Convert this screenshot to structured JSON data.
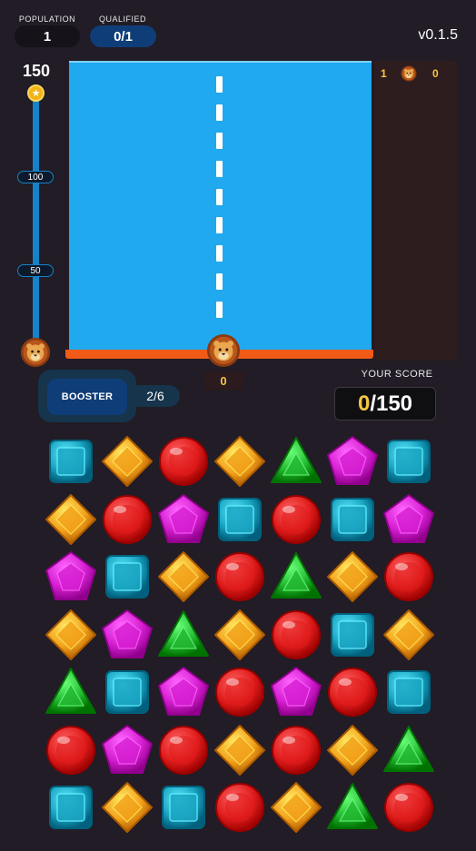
{
  "stats": {
    "population_label": "POPULATION",
    "population_value": "1",
    "qualified_label": "QUALIFIED",
    "qualified_value": "0/1"
  },
  "version": "v0.1.5",
  "progress": {
    "max_label": "150",
    "marks": [
      "100",
      "50"
    ],
    "star_icon": "star-icon"
  },
  "arena": {
    "player_count": "0",
    "colors": {
      "sky": "#20a9ee",
      "floor": "#f15a17"
    }
  },
  "leaderboard": {
    "rank": "1",
    "score": "0"
  },
  "booster": {
    "label": "BOOSTER",
    "count": "2/6"
  },
  "score": {
    "label": "YOUR SCORE",
    "current": "0",
    "target": "/150"
  },
  "board": {
    "rows": [
      [
        "cube",
        "diamond",
        "ruby",
        "diamond",
        "triangle",
        "pentagon",
        "cube"
      ],
      [
        "diamond",
        "ruby",
        "pentagon",
        "cube",
        "ruby",
        "cube",
        "pentagon"
      ],
      [
        "pentagon",
        "cube",
        "diamond",
        "ruby",
        "triangle",
        "diamond",
        "ruby"
      ],
      [
        "diamond",
        "pentagon",
        "triangle",
        "diamond",
        "ruby",
        "cube",
        "diamond"
      ],
      [
        "triangle",
        "cube",
        "pentagon",
        "ruby",
        "pentagon",
        "ruby",
        "cube"
      ],
      [
        "ruby",
        "pentagon",
        "ruby",
        "diamond",
        "ruby",
        "diamond",
        "triangle"
      ],
      [
        "cube",
        "diamond",
        "cube",
        "ruby",
        "diamond",
        "triangle",
        "ruby"
      ]
    ],
    "gem_colors": {
      "cube": "#1ba6c3",
      "diamond": "#f2a019",
      "ruby": "#e01c1c",
      "triangle": "#23b832",
      "pentagon": "#d61fd2"
    }
  }
}
